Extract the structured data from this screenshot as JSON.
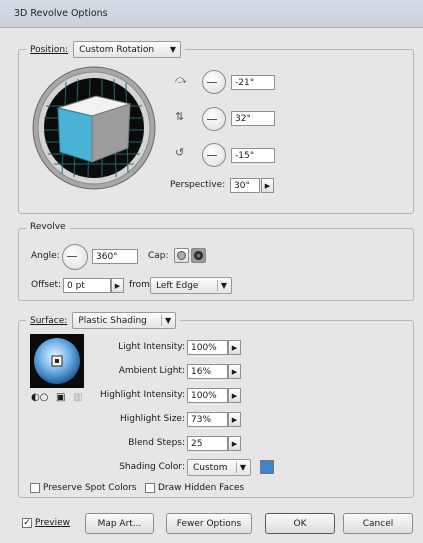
{
  "window": {
    "title": "3D Revolve Options"
  },
  "position": {
    "label": "Position:",
    "preset": "Custom Rotation",
    "x_angle": "-21°",
    "y_angle": "32°",
    "z_angle": "-15°",
    "perspective_label": "Perspective:",
    "perspective_value": "30°",
    "x_icon": "rotate-x-icon",
    "y_icon": "rotate-y-icon",
    "z_icon": "rotate-z-icon"
  },
  "revolve": {
    "title": "Revolve",
    "angle_label": "Angle:",
    "angle_value": "360°",
    "cap_label": "Cap:",
    "offset_label": "Offset:",
    "offset_value": "0 pt",
    "from_label": "from",
    "from_value": "Left Edge"
  },
  "surface": {
    "label": "Surface:",
    "value": "Plastic Shading",
    "light_intensity_label": "Light Intensity:",
    "light_intensity": "100%",
    "ambient_light_label": "Ambient Light:",
    "ambient_light": "16%",
    "highlight_intensity_label": "Highlight Intensity:",
    "highlight_intensity": "100%",
    "highlight_size_label": "Highlight Size:",
    "highlight_size": "73%",
    "blend_steps_label": "Blend Steps:",
    "blend_steps": "25",
    "shading_color_label": "Shading Color:",
    "shading_color": "Custom",
    "shading_swatch": "#3b86c9",
    "preserve_spot_label": "Preserve Spot Colors",
    "draw_hidden_label": "Draw Hidden Faces"
  },
  "footer": {
    "preview_label": "Preview",
    "map_art_label": "Map Art...",
    "fewer_options_label": "Fewer Options",
    "ok_label": "OK",
    "cancel_label": "Cancel"
  }
}
